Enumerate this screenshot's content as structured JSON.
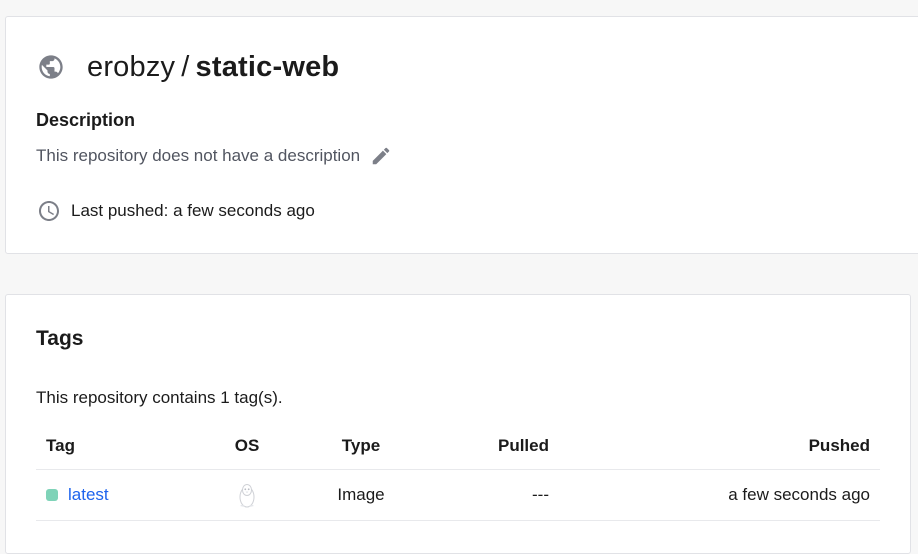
{
  "repository": {
    "owner": "erobzy",
    "separator": "/",
    "name": "static-web",
    "visibility_icon": "globe-icon",
    "description_heading": "Description",
    "description_text": "This repository does not have a description",
    "edit_icon": "pencil-icon",
    "last_pushed": "Last pushed: a few seconds ago",
    "clock_icon": "clock-icon"
  },
  "tags": {
    "heading": "Tags",
    "summary": "This repository contains 1 tag(s).",
    "columns": {
      "tag": "Tag",
      "os": "OS",
      "type": "Type",
      "pulled": "Pulled",
      "pushed": "Pushed"
    },
    "rows": [
      {
        "tag": "latest",
        "os_icon": "linux-icon",
        "type": "Image",
        "pulled": "---",
        "pushed": "a few seconds ago",
        "status_color": "#7fd3b8"
      }
    ]
  },
  "colors": {
    "link": "#1d63ed",
    "icon_gray": "#7c7f88",
    "status_green": "#7fd3b8"
  }
}
